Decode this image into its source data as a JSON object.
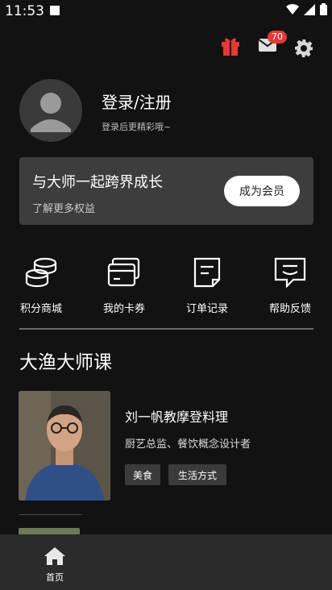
{
  "status_bar": {
    "time": "11:53"
  },
  "header": {
    "mail_badge": "70"
  },
  "profile": {
    "login_title": "登录/注册",
    "login_subtitle": "登录后更精彩哦~"
  },
  "member": {
    "title": "与大师一起跨界成长",
    "subtitle": "了解更多权益",
    "button": "成为会员"
  },
  "actions": [
    {
      "label": "积分商城",
      "icon": "coins-icon"
    },
    {
      "label": "我的卡券",
      "icon": "card-icon"
    },
    {
      "label": "订单记录",
      "icon": "order-icon"
    },
    {
      "label": "帮助反馈",
      "icon": "feedback-icon"
    }
  ],
  "section": {
    "title": "大渔大师课"
  },
  "course": {
    "title": "刘一帆教摩登料理",
    "subtitle": "厨艺总监、餐饮概念设计者",
    "tags": [
      "美食",
      "生活方式"
    ]
  },
  "bottom_nav": {
    "home_label": "首页"
  }
}
